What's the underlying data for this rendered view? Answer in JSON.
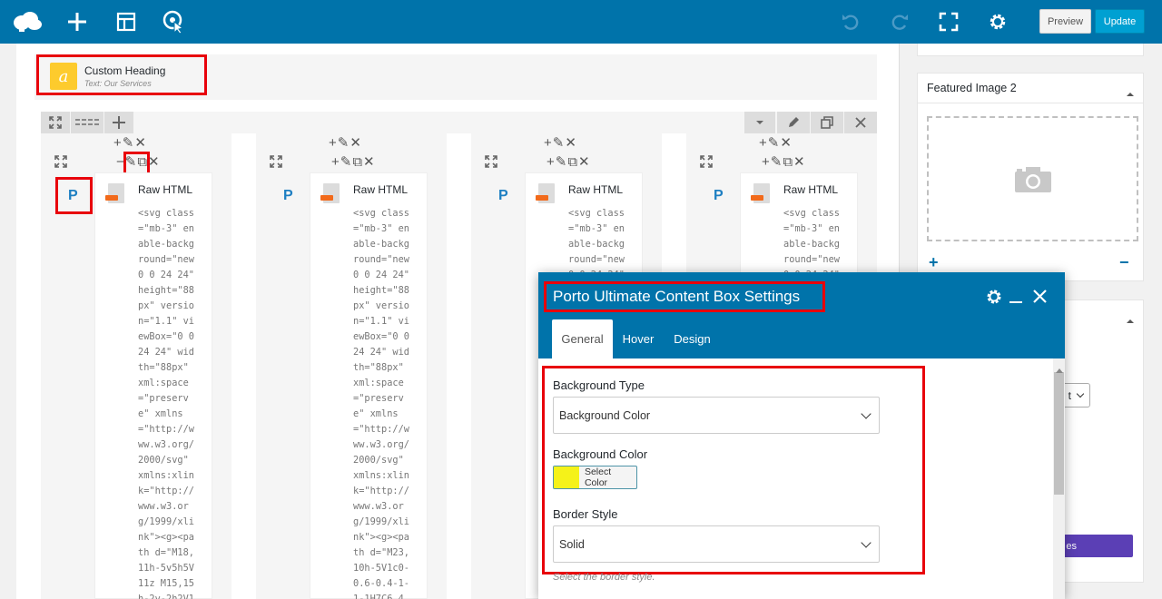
{
  "toolbar": {
    "preview_label": "Preview",
    "update_label": "Update",
    "icons": [
      "cloud-logo-icon",
      "plus-icon",
      "layout-icon",
      "cursor-target-icon",
      "undo-icon",
      "redo-icon",
      "fullscreen-icon",
      "gear-icon"
    ]
  },
  "custom_heading": {
    "title": "Custom Heading",
    "subtitle": "Text: Our Services",
    "icon_letter": "a"
  },
  "columns": [
    {
      "p_label": "P",
      "card_title": "Raw HTML",
      "code": "<svg class\n=\"mb-3\" en\nable-backg\nround=\"new\n0 0 24 24\"\nheight=\"88\npx\" versio\nn=\"1.1\" vi\newBox=\"0 0\n24 24\" wid\nth=\"88px\"\nxml:space\n=\"preserv\ne\" xmlns\n=\"http://w\nww.w3.org/\n2000/svg\"\nxmlns:xlin\nk=\"http://\nwww.w3.or\ng/1999/xli\nnk\"><g><pa\nth d=\"M18,\n11h-5v5h5V\n11z M15,15\nh-2v-2h2V1\n"
    },
    {
      "p_label": "P",
      "card_title": "Raw HTML",
      "code": "<svg class\n=\"mb-3\" en\nable-backg\nround=\"new\n0 0 24 24\"\nheight=\"88\npx\" versio\nn=\"1.1\" vi\newBox=\"0 0\n24 24\" wid\nth=\"88px\"\nxml:space\n=\"preserv\ne\" xmlns\n=\"http://w\nww.w3.org/\n2000/svg\"\nxmlns:xlin\nk=\"http://\nwww.w3.or\ng/1999/xli\nnk\"><g><pa\nth d=\"M23,\n10h-5V1c0-\n0.6-0.4-1-\n1-1H7C6.4,\n"
    },
    {
      "p_label": "P",
      "card_title": "Raw HTML",
      "code": "<svg class\n=\"mb-3\" en\nable-backg\nround=\"new\n0 0 24 24\"\n"
    },
    {
      "p_label": "P",
      "card_title": "Raw HTML",
      "code": "<svg class\n=\"mb-3\" en\nable-backg\nround=\"new\n0 0 24 24\"\n"
    }
  ],
  "sidebar": {
    "featured_title": "Featured Image 2",
    "button_partial": "es",
    "select_partial": "t"
  },
  "modal": {
    "title": "Porto Ultimate Content Box Settings",
    "tabs": [
      "General",
      "Hover",
      "Design"
    ],
    "active_tab": "General",
    "fields": {
      "background_type_label": "Background Type",
      "background_type_value": "Background Color",
      "background_color_label": "Background Color",
      "select_color_label": "Select Color",
      "swatch_color": "#f5f219",
      "border_style_label": "Border Style",
      "border_style_value": "Solid",
      "border_style_hint": "Select the border style."
    }
  },
  "colors": {
    "toolbar": "#0073aa",
    "update": "#00a0d2",
    "highlight": "#e8000b",
    "purple_button": "#5b3fb5"
  }
}
